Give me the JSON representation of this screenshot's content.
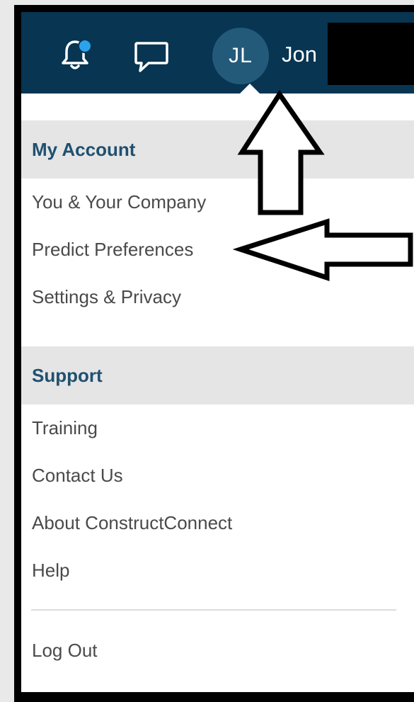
{
  "header": {
    "avatar_initials": "JL",
    "username_visible": "Jon",
    "notification_indicator_color": "#2aa3ea",
    "bar_color": "#073552",
    "icons": [
      "bell-icon",
      "chat-icon"
    ]
  },
  "my_account": {
    "title": "My Account",
    "items": [
      "You & Your Company",
      "Predict Preferences",
      "Settings & Privacy"
    ]
  },
  "support": {
    "title": "Support",
    "items": [
      "Training",
      "Contact Us",
      "About ConstructConnect",
      "Help"
    ]
  },
  "logout_label": "Log Out"
}
